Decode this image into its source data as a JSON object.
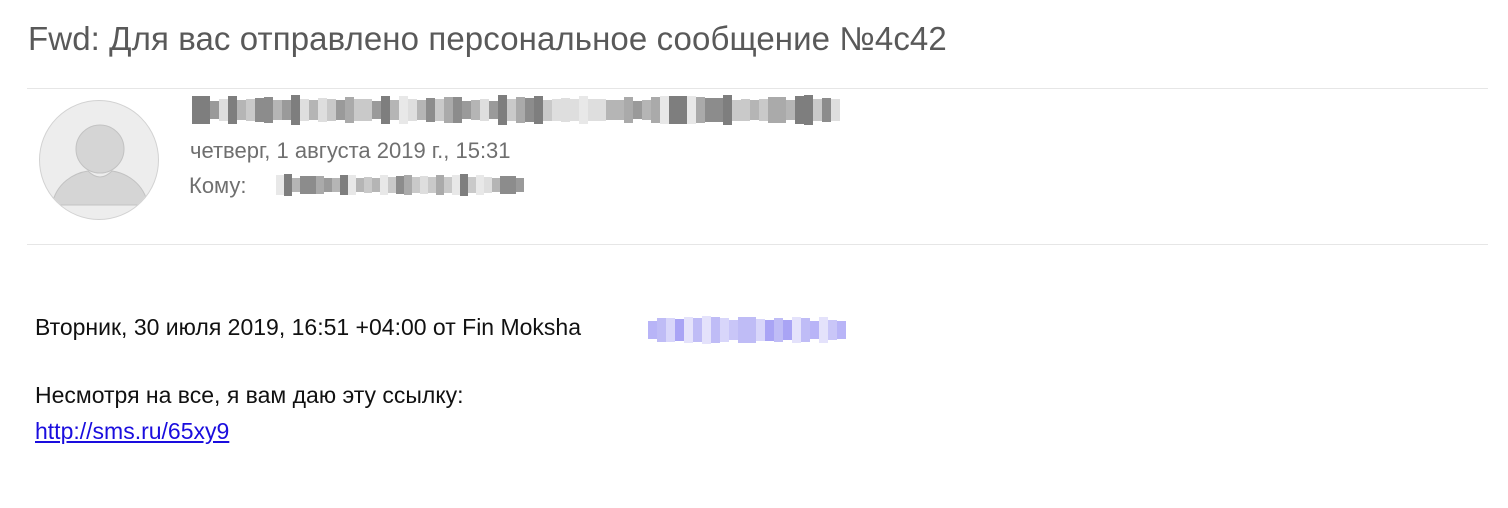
{
  "message": {
    "subject": "Fwd: Для вас отправлено персональное сообщение №4c42",
    "date": "четверг, 1 августа 2019 г., 15:31",
    "to_label": "Кому:",
    "body": {
      "forward_header": "Вторник, 30 июля 2019, 16:51 +04:00 от Fin Moksha",
      "text": "Несмотря на все, я вам даю эту ссылку:",
      "link": "http://sms.ru/65xy9"
    }
  },
  "icons": {
    "avatar": "default-person-avatar-icon"
  },
  "colors": {
    "subject": "#595959",
    "meta_text": "#6f6f6f",
    "body_text": "#111111",
    "link": "#1a0dde",
    "redacted_link_tint": "#b8b4f7",
    "divider": "#e6e6e6",
    "avatar_bg": "#ededed",
    "avatar_figure": "#d5d5d5"
  }
}
